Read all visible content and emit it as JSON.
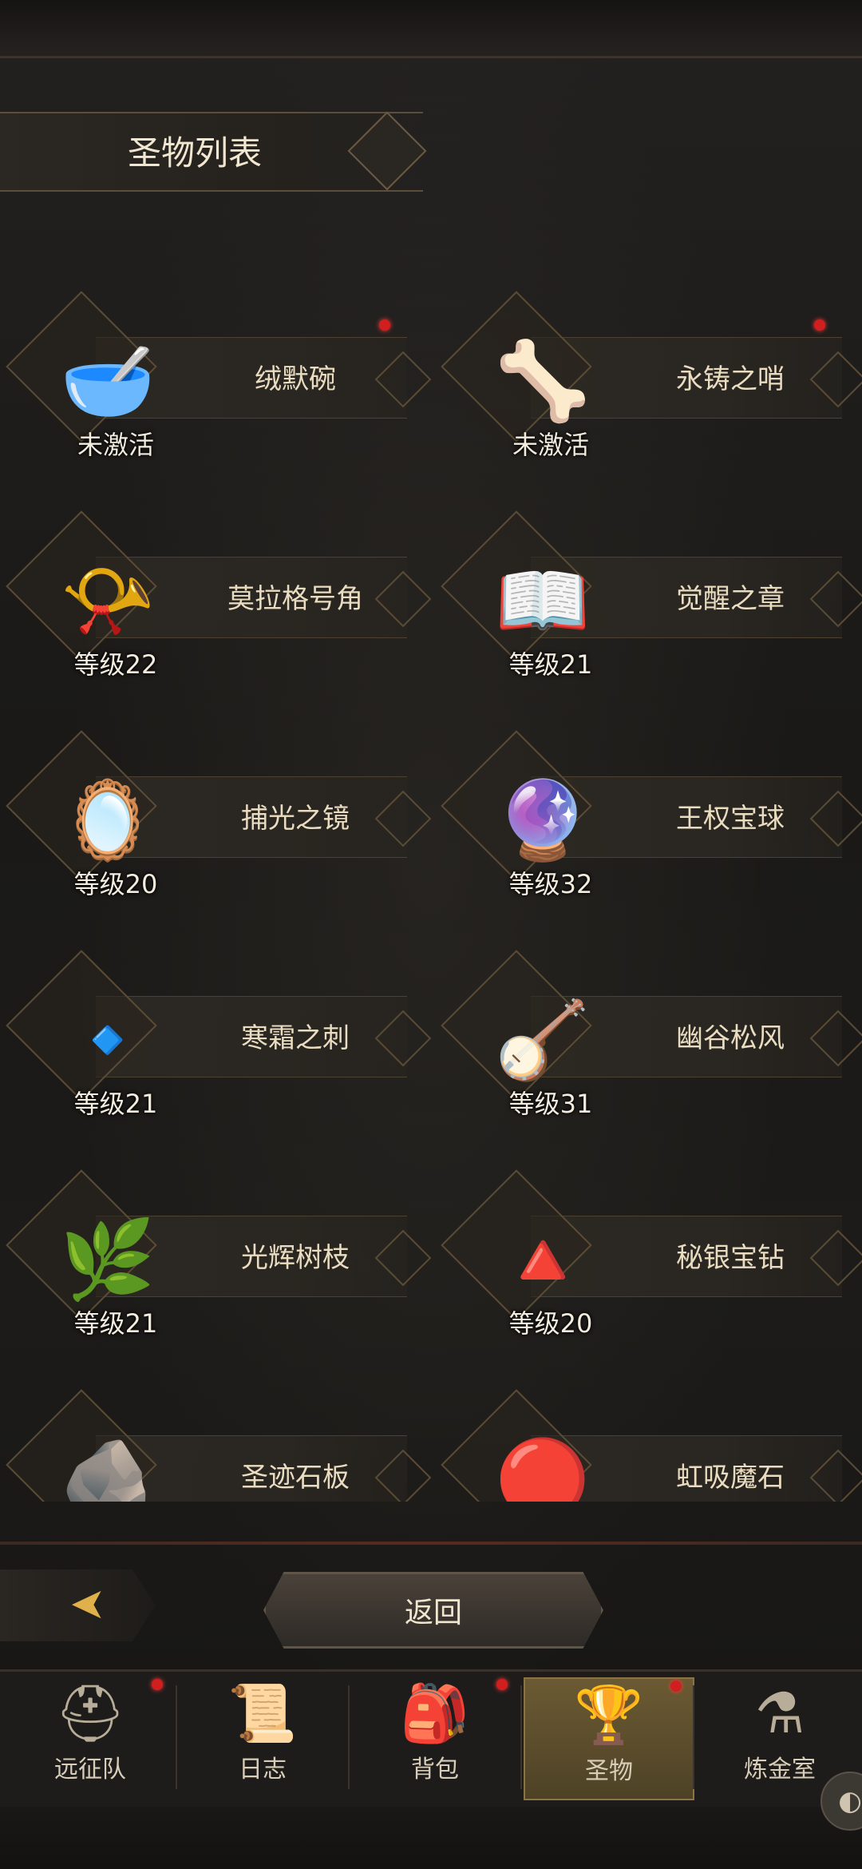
{
  "page": {
    "title": "圣物列表"
  },
  "relics": [
    {
      "name": "绒默碗",
      "status": "未激活",
      "icon": "bowl-icon",
      "glyph": "🥣",
      "badge": true
    },
    {
      "name": "永铸之哨",
      "status": "未激活",
      "icon": "whistle-icon",
      "glyph": "🦴",
      "badge": true
    },
    {
      "name": "莫拉格号角",
      "status": "等级22",
      "icon": "horn-icon",
      "glyph": "📯",
      "badge": false
    },
    {
      "name": "觉醒之章",
      "status": "等级21",
      "icon": "tome-icon",
      "glyph": "📖",
      "badge": false
    },
    {
      "name": "捕光之镜",
      "status": "等级20",
      "icon": "mirror-icon",
      "glyph": "🪞",
      "badge": false
    },
    {
      "name": "王权宝球",
      "status": "等级32",
      "icon": "orb-icon",
      "glyph": "🔮",
      "badge": false
    },
    {
      "name": "寒霜之刺",
      "status": "等级21",
      "icon": "ice-shard-icon",
      "glyph": "🔹",
      "badge": false
    },
    {
      "name": "幽谷松风",
      "status": "等级31",
      "icon": "lute-icon",
      "glyph": "🪕",
      "badge": false
    },
    {
      "name": "光辉树枝",
      "status": "等级21",
      "icon": "branch-icon",
      "glyph": "🌿",
      "badge": false
    },
    {
      "name": "秘银宝钻",
      "status": "等级20",
      "icon": "pyramid-icon",
      "glyph": "🔺",
      "badge": false
    },
    {
      "name": "圣迹石板",
      "status": "",
      "icon": "stone-tablet-icon",
      "glyph": "🪨",
      "badge": false
    },
    {
      "name": "虹吸魔石",
      "status": "",
      "icon": "red-stone-icon",
      "glyph": "🔴",
      "badge": false
    }
  ],
  "footer": {
    "back_label": "返回",
    "back_arrow_glyph": "➤"
  },
  "tabs": [
    {
      "label": "远征队",
      "glyph": "⛑",
      "icon": "helmet-icon",
      "badge": true
    },
    {
      "label": "日志",
      "glyph": "📜",
      "icon": "scroll-icon",
      "badge": false
    },
    {
      "label": "背包",
      "glyph": "🎒",
      "icon": "bag-icon",
      "badge": true
    },
    {
      "label": "圣物",
      "glyph": "🏆",
      "icon": "chalice-icon",
      "badge": true,
      "active": true
    },
    {
      "label": "炼金室",
      "glyph": "⚗",
      "icon": "alchemy-icon",
      "badge": false
    }
  ],
  "colors": {
    "badge": "#d11e1e",
    "active_tab": "#6b5a33",
    "gold": "#e0b04a"
  }
}
